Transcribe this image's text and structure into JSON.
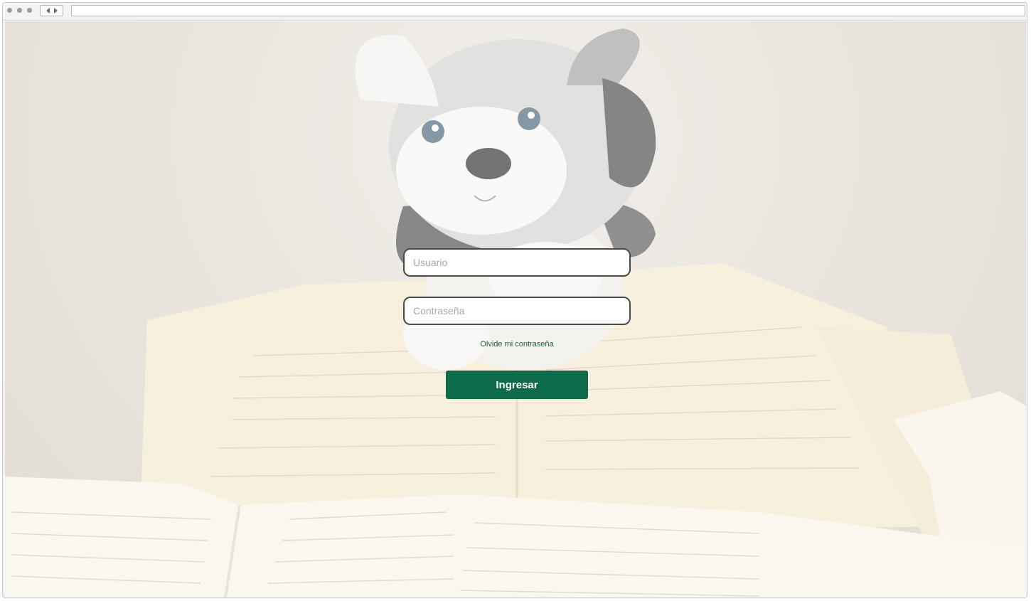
{
  "login": {
    "username_placeholder": "Usuario",
    "password_placeholder": "Contraseña",
    "forgot_password_label": "Olvide mi contraseña",
    "submit_label": "Ingresar"
  },
  "background": {
    "subject": "plush husky dog toy sitting behind open books on a carpet"
  },
  "colors": {
    "primary_button": "#0d6b4c",
    "link": "#1f5e3c",
    "field_border": "#4a4a4a"
  }
}
